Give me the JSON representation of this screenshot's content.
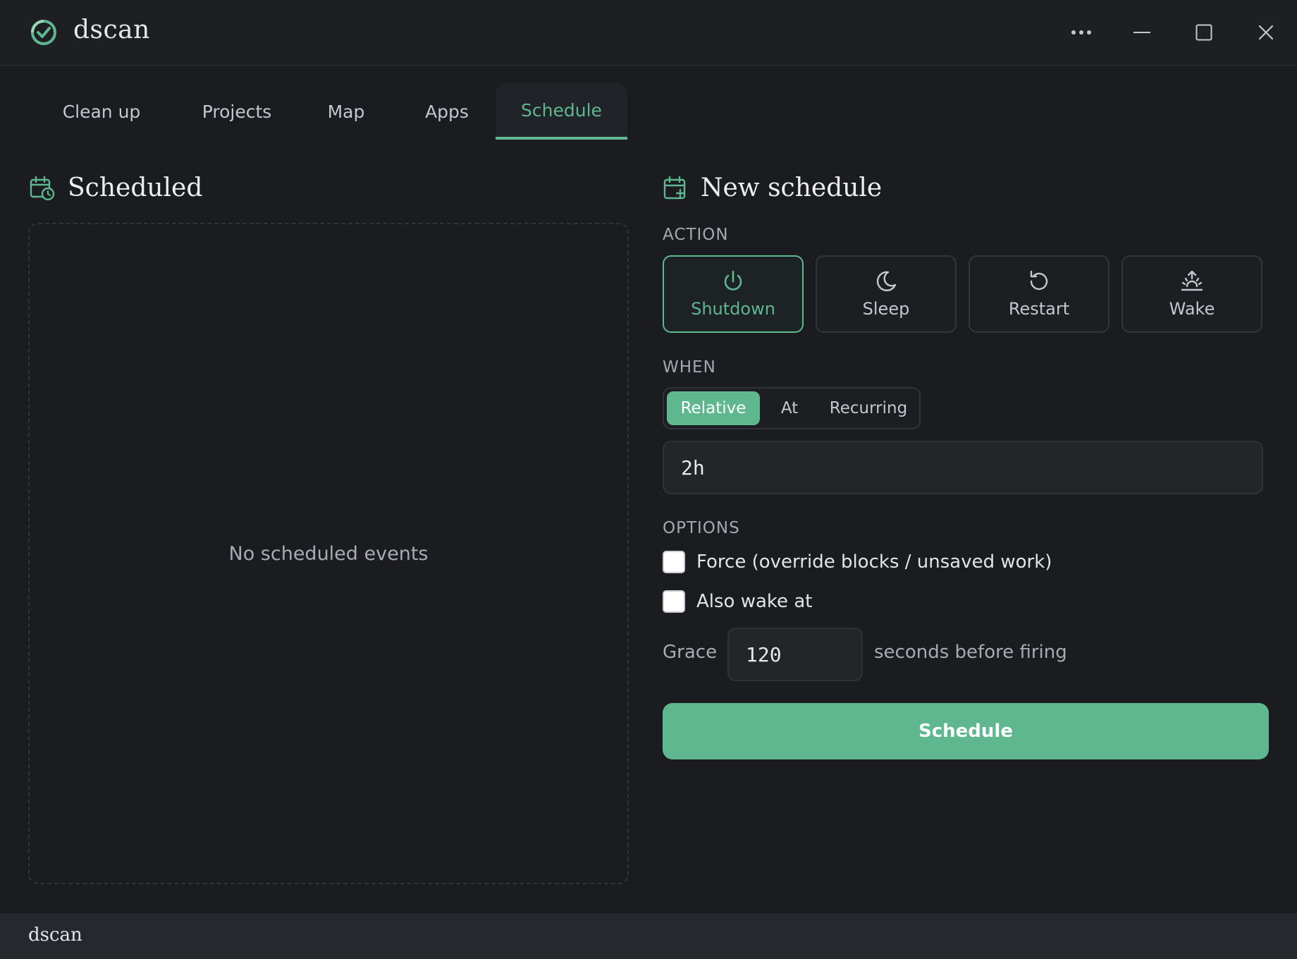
{
  "app": {
    "title": "dscan",
    "accent": "#5fb78f"
  },
  "tabs": [
    {
      "label": "Clean up"
    },
    {
      "label": "Projects"
    },
    {
      "label": "Map"
    },
    {
      "label": "Apps"
    },
    {
      "label": "Schedule",
      "active": true
    }
  ],
  "scheduled": {
    "title": "Scheduled",
    "empty_text": "No scheduled events"
  },
  "new_schedule": {
    "title": "New schedule",
    "action_label": "ACTION",
    "actions": [
      {
        "label": "Shutdown",
        "icon": "power-icon",
        "selected": true
      },
      {
        "label": "Sleep",
        "icon": "moon-icon"
      },
      {
        "label": "Restart",
        "icon": "restart-icon"
      },
      {
        "label": "Wake",
        "icon": "sunrise-icon"
      }
    ],
    "when_label": "WHEN",
    "when_modes": [
      {
        "label": "Relative",
        "active": true
      },
      {
        "label": "At"
      },
      {
        "label": "Recurring"
      }
    ],
    "when_value": "2h",
    "options_label": "OPTIONS",
    "options": [
      {
        "label": "Force (override blocks / unsaved work)",
        "checked": false
      },
      {
        "label": "Also wake at",
        "checked": false
      }
    ],
    "grace_label": "Grace",
    "grace_value": "120",
    "grace_suffix": "seconds before firing",
    "submit_label": "Schedule"
  },
  "status_bar": {
    "text": "dscan"
  }
}
